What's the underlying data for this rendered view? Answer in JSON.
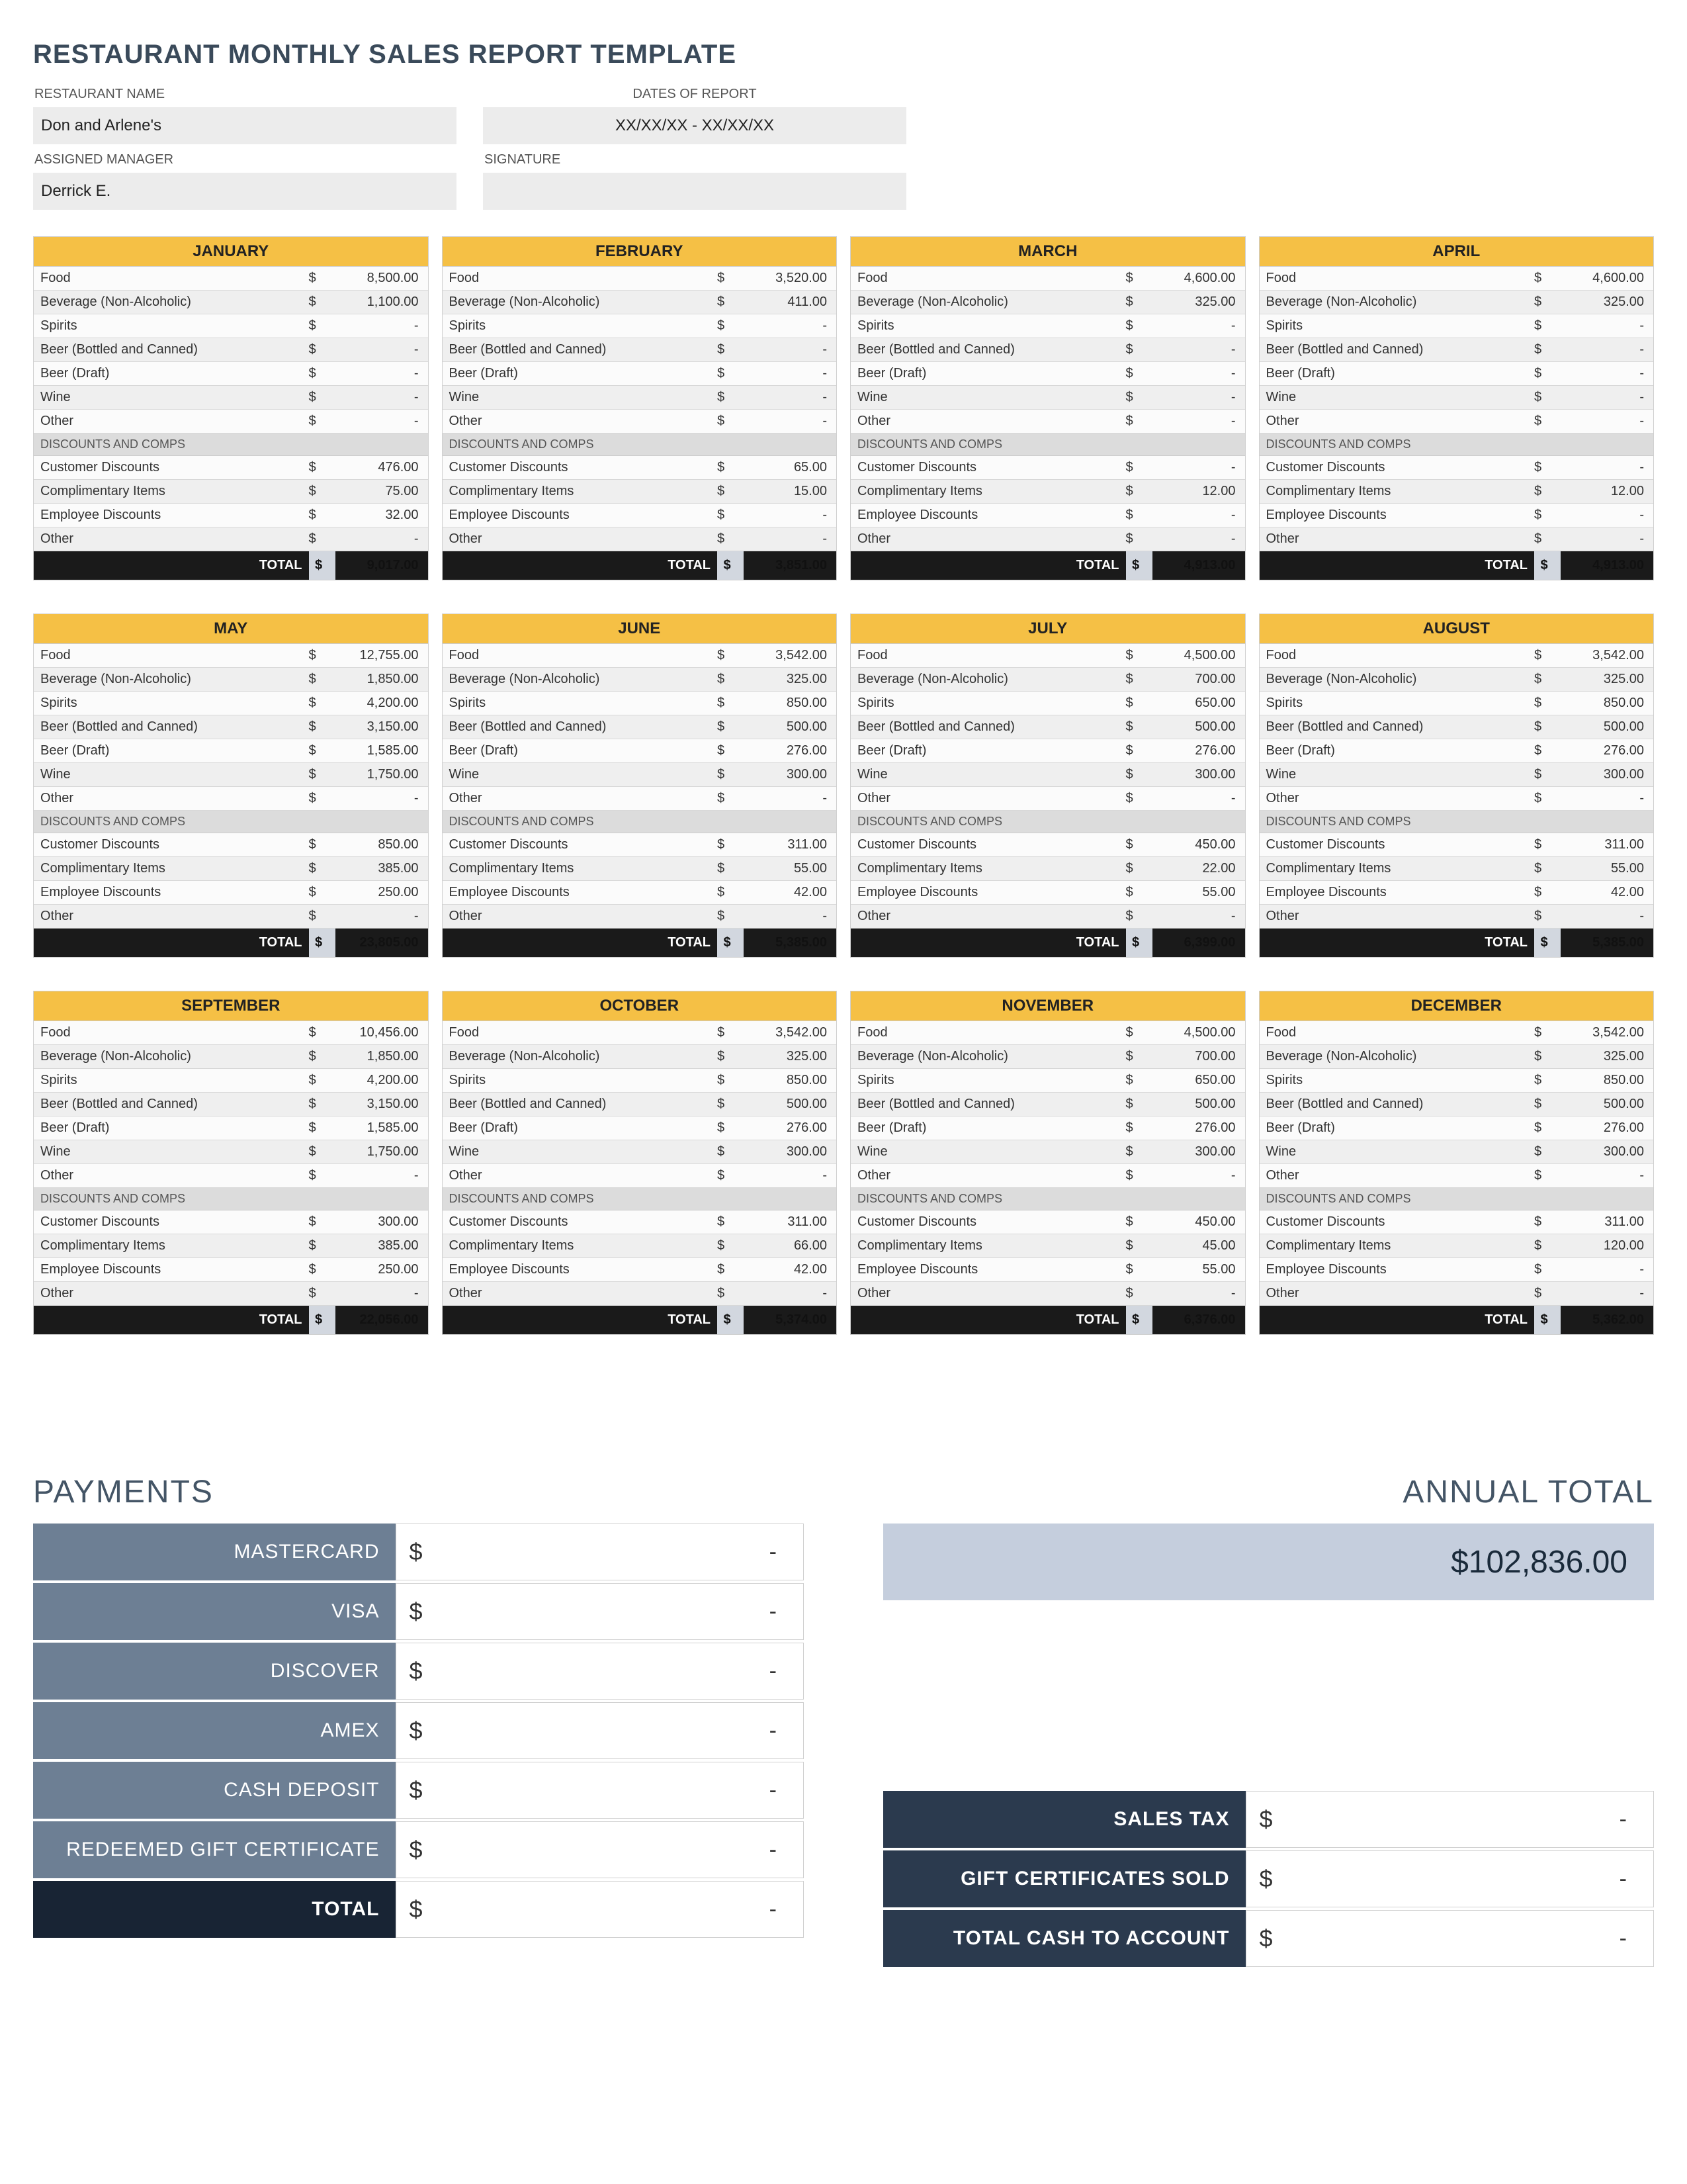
{
  "title": "RESTAURANT MONTHLY SALES REPORT TEMPLATE",
  "header": {
    "restaurant_name_label": "RESTAURANT NAME",
    "restaurant_name": "Don and Arlene's",
    "dates_label": "DATES OF REPORT",
    "dates": "XX/XX/XX - XX/XX/XX",
    "manager_label": "ASSIGNED MANAGER",
    "manager": "Derrick E.",
    "signature_label": "SIGNATURE",
    "signature": ""
  },
  "sales_categories": [
    "Food",
    "Beverage (Non-Alcoholic)",
    "Spirits",
    "Beer (Bottled and Canned)",
    "Beer (Draft)",
    "Wine",
    "Other"
  ],
  "discounts_label": "DISCOUNTS AND COMPS",
  "discount_categories": [
    "Customer Discounts",
    "Complimentary Items",
    "Employee Discounts",
    "Other"
  ],
  "total_label": "TOTAL",
  "currency": "$",
  "dash": "-",
  "months": [
    {
      "name": "JANUARY",
      "sales": [
        "8,500.00",
        "1,100.00",
        "-",
        "-",
        "-",
        "-",
        "-"
      ],
      "discounts": [
        "476.00",
        "75.00",
        "32.00",
        "-"
      ],
      "total": "9,017.00"
    },
    {
      "name": "FEBRUARY",
      "sales": [
        "3,520.00",
        "411.00",
        "-",
        "-",
        "-",
        "-",
        "-"
      ],
      "discounts": [
        "65.00",
        "15.00",
        "-",
        "-"
      ],
      "total": "3,851.00"
    },
    {
      "name": "MARCH",
      "sales": [
        "4,600.00",
        "325.00",
        "-",
        "-",
        "-",
        "-",
        "-"
      ],
      "discounts": [
        "-",
        "12.00",
        "-",
        "-"
      ],
      "total": "4,913.00"
    },
    {
      "name": "APRIL",
      "sales": [
        "4,600.00",
        "325.00",
        "-",
        "-",
        "-",
        "-",
        "-"
      ],
      "discounts": [
        "-",
        "12.00",
        "-",
        "-"
      ],
      "total": "4,913.00"
    },
    {
      "name": "MAY",
      "sales": [
        "12,755.00",
        "1,850.00",
        "4,200.00",
        "3,150.00",
        "1,585.00",
        "1,750.00",
        "-"
      ],
      "discounts": [
        "850.00",
        "385.00",
        "250.00",
        "-"
      ],
      "total": "23,805.00"
    },
    {
      "name": "JUNE",
      "sales": [
        "3,542.00",
        "325.00",
        "850.00",
        "500.00",
        "276.00",
        "300.00",
        "-"
      ],
      "discounts": [
        "311.00",
        "55.00",
        "42.00",
        "-"
      ],
      "total": "5,385.00"
    },
    {
      "name": "JULY",
      "sales": [
        "4,500.00",
        "700.00",
        "650.00",
        "500.00",
        "276.00",
        "300.00",
        "-"
      ],
      "discounts": [
        "450.00",
        "22.00",
        "55.00",
        "-"
      ],
      "total": "6,399.00"
    },
    {
      "name": "AUGUST",
      "sales": [
        "3,542.00",
        "325.00",
        "850.00",
        "500.00",
        "276.00",
        "300.00",
        "-"
      ],
      "discounts": [
        "311.00",
        "55.00",
        "42.00",
        "-"
      ],
      "total": "5,385.00"
    },
    {
      "name": "SEPTEMBER",
      "sales": [
        "10,456.00",
        "1,850.00",
        "4,200.00",
        "3,150.00",
        "1,585.00",
        "1,750.00",
        "-"
      ],
      "discounts": [
        "300.00",
        "385.00",
        "250.00",
        "-"
      ],
      "total": "22,056.00"
    },
    {
      "name": "OCTOBER",
      "sales": [
        "3,542.00",
        "325.00",
        "850.00",
        "500.00",
        "276.00",
        "300.00",
        "-"
      ],
      "discounts": [
        "311.00",
        "66.00",
        "42.00",
        "-"
      ],
      "total": "5,374.00"
    },
    {
      "name": "NOVEMBER",
      "sales": [
        "4,500.00",
        "700.00",
        "650.00",
        "500.00",
        "276.00",
        "300.00",
        "-"
      ],
      "discounts": [
        "450.00",
        "45.00",
        "55.00",
        "-"
      ],
      "total": "6,376.00"
    },
    {
      "name": "DECEMBER",
      "sales": [
        "3,542.00",
        "325.00",
        "850.00",
        "500.00",
        "276.00",
        "300.00",
        "-"
      ],
      "discounts": [
        "311.00",
        "120.00",
        "-",
        "-"
      ],
      "total": "5,362.00"
    }
  ],
  "payments_heading": "PAYMENTS",
  "payments": [
    {
      "label": "MASTERCARD",
      "value": "-"
    },
    {
      "label": "VISA",
      "value": "-"
    },
    {
      "label": "DISCOVER",
      "value": "-"
    },
    {
      "label": "AMEX",
      "value": "-"
    },
    {
      "label": "CASH DEPOSIT",
      "value": "-"
    },
    {
      "label": "REDEEMED GIFT CERTIFICATE",
      "value": "-"
    }
  ],
  "payments_total": {
    "label": "TOTAL",
    "value": "-"
  },
  "annual_heading": "ANNUAL TOTAL",
  "annual_total": "$102,836.00",
  "summary_rows": [
    {
      "label": "SALES TAX",
      "value": "-"
    },
    {
      "label": "GIFT CERTIFICATES SOLD",
      "value": "-"
    },
    {
      "label": "TOTAL CASH TO ACCOUNT",
      "value": "-"
    }
  ]
}
